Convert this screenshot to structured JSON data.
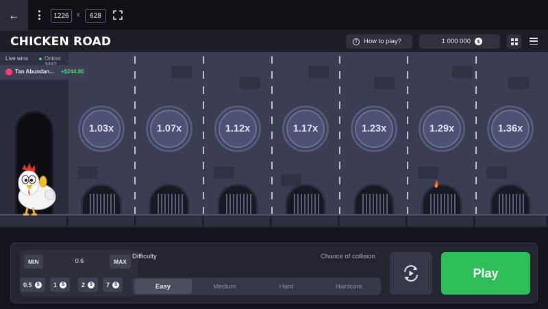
{
  "toolbar": {
    "width_value": "1226",
    "separator": "x",
    "height_value": "628"
  },
  "header": {
    "logo": "CHICKEN ROAD",
    "how_to_play": "How to play?",
    "balance": "1 000 000",
    "currency_symbol": "$"
  },
  "live": {
    "label": "Live wins",
    "online": "Online: 3487",
    "winner_name": "Tan Abundan...",
    "winner_amount": "+$244.80"
  },
  "lanes": {
    "multipliers": [
      "1.03x",
      "1.07x",
      "1.12x",
      "1.17x",
      "1.23x",
      "1.29x",
      "1.36x"
    ]
  },
  "controls": {
    "min_label": "MIN",
    "max_label": "MAX",
    "bet_value": "0.6",
    "quick_bets": [
      "0.5",
      "1",
      "2",
      "7"
    ],
    "difficulty_label": "Difficulty",
    "collision_label": "Chance of collision",
    "difficulties": [
      "Easy",
      "Medium",
      "Hard",
      "Hardcore"
    ],
    "selected_difficulty": "Easy",
    "play_label": "Play"
  },
  "colors": {
    "accent_green": "#2dbe57",
    "win_green": "#4cd964",
    "scene_bg": "#3b3e52",
    "panel_bg": "#24262f"
  }
}
